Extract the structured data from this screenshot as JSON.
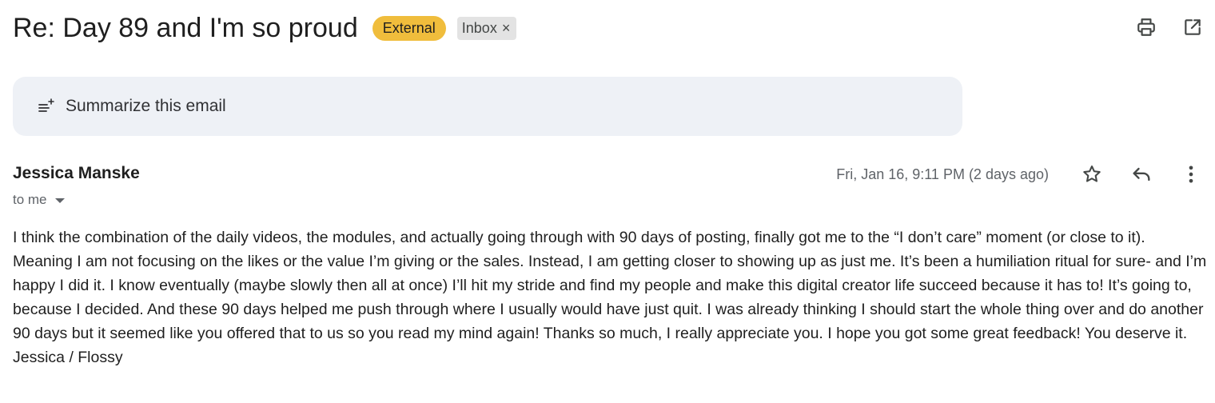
{
  "header": {
    "subject": "Re: Day 89 and I'm so proud",
    "badge_external": "External",
    "label_inbox": "Inbox",
    "label_remove": "×"
  },
  "summarize": {
    "label": "Summarize this email"
  },
  "message": {
    "sender": "Jessica Manske",
    "recipient": "to me",
    "date": "Fri, Jan 16, 9:11 PM (2 days ago)",
    "body": "I think the combination of the daily videos, the modules, and actually going through with 90 days of posting, finally got me to the “I don’t care” moment (or close to it).  Meaning I am not focusing on the likes or the value I’m giving or the sales. Instead, I am getting closer to showing up as just me. It’s been a humiliation ritual for sure- and I’m happy I did it. I know eventually (maybe slowly then all at once) I’ll hit my stride and find my people and make this digital creator life succeed because it has to! It’s going to, because I decided. And these 90 days helped me push through where I usually would have just quit. I was already thinking I should start the whole thing over and do another 90 days but it seemed like you offered that to us so you read my mind again! Thanks so much, I really appreciate you. I hope you got some great feedback! You deserve it.",
    "signature": "Jessica / Flossy"
  },
  "icons": {
    "print": "print-icon",
    "open_new_window": "open-in-new-window-icon",
    "summarize": "sparkle-lines-icon",
    "star": "star-icon",
    "reply": "reply-icon",
    "more": "more-vertical-icon",
    "dropdown": "caret-down-icon"
  },
  "colors": {
    "external_badge": "#f0bd3c",
    "inbox_label_bg": "#e3e3e3",
    "summarize_bg": "#eef1f6"
  }
}
